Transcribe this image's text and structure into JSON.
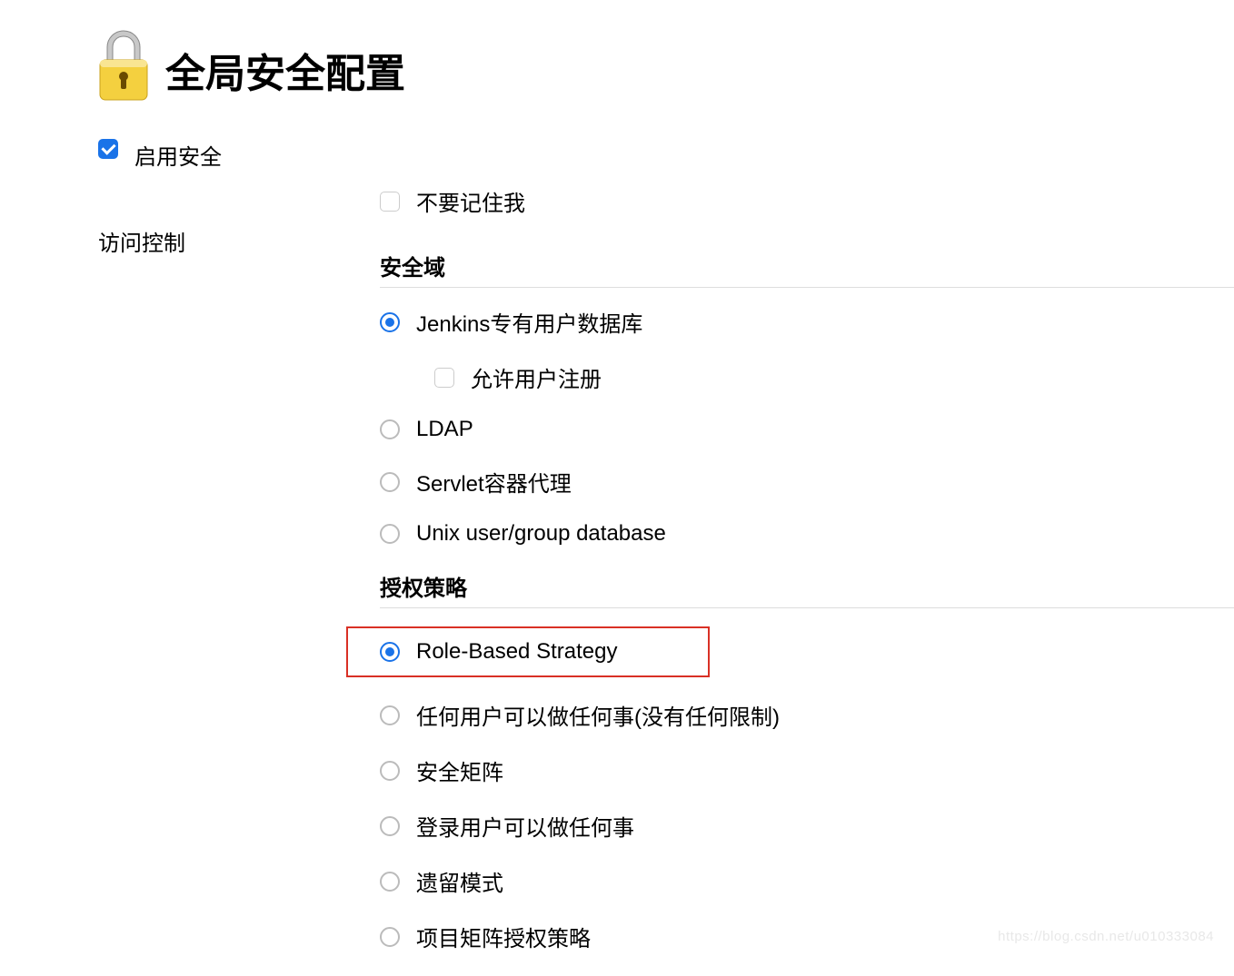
{
  "page_title": "全局安全配置",
  "enable_security": {
    "label": "启用安全",
    "checked": true
  },
  "access_control_label": "访问控制",
  "remember_me": {
    "label": "不要记住我",
    "checked": false
  },
  "security_realm": {
    "heading": "安全域",
    "options": [
      {
        "label": "Jenkins专有用户数据库",
        "selected": true
      },
      {
        "label": "LDAP",
        "selected": false
      },
      {
        "label": "Servlet容器代理",
        "selected": false
      },
      {
        "label": "Unix user/group database",
        "selected": false
      }
    ],
    "allow_signup": {
      "label": "允许用户注册",
      "checked": false
    }
  },
  "authorization": {
    "heading": "授权策略",
    "options": [
      {
        "label": "Role-Based Strategy",
        "selected": true,
        "highlighted": true
      },
      {
        "label": "任何用户可以做任何事(没有任何限制)",
        "selected": false
      },
      {
        "label": "安全矩阵",
        "selected": false
      },
      {
        "label": "登录用户可以做任何事",
        "selected": false
      },
      {
        "label": "遗留模式",
        "selected": false
      },
      {
        "label": "项目矩阵授权策略",
        "selected": false
      }
    ]
  },
  "watermark": "https://blog.csdn.net/u010333084"
}
